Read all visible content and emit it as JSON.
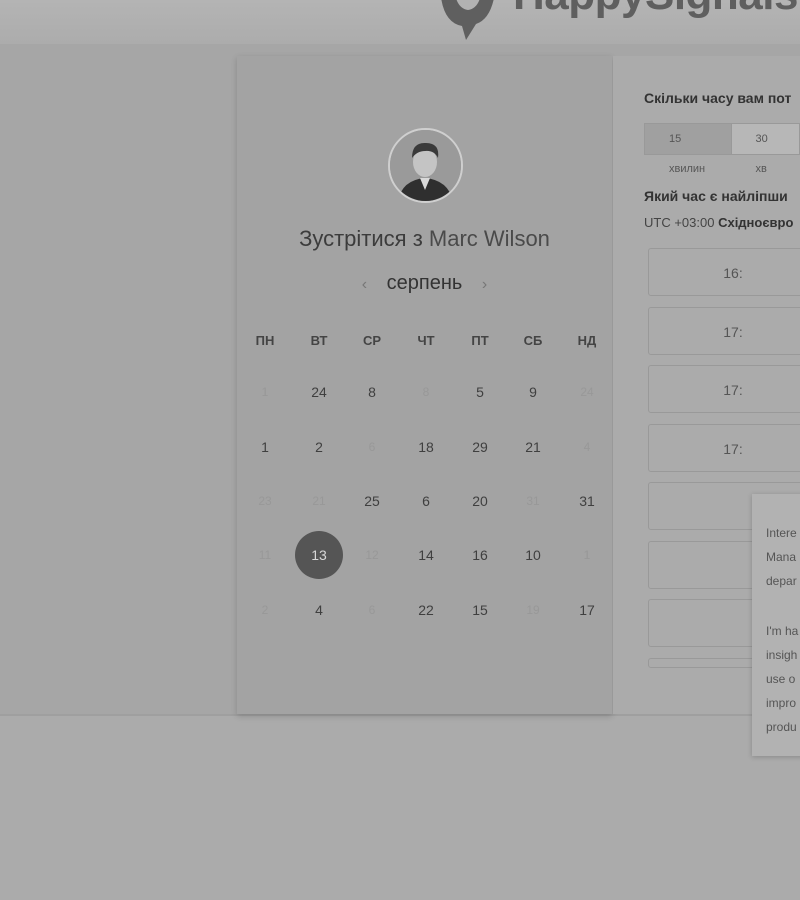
{
  "brand": {
    "name": "HappySignals"
  },
  "calendar": {
    "title_prefix": "Зустрітися з",
    "host_name": "Marc Wilson",
    "month": "серпень",
    "prev_arrow": "‹",
    "next_arrow": "›",
    "weekdays": [
      "ПН",
      "ВТ",
      "СР",
      "ЧТ",
      "ПТ",
      "СБ",
      "НД"
    ],
    "weeks": [
      [
        {
          "d": "1",
          "dim": true
        },
        {
          "d": "24"
        },
        {
          "d": "8"
        },
        {
          "d": "8",
          "dim": true
        },
        {
          "d": "5"
        },
        {
          "d": "9"
        },
        {
          "d": "24",
          "dim": true
        }
      ],
      [
        {
          "d": "1"
        },
        {
          "d": "2"
        },
        {
          "d": "6",
          "dim": true
        },
        {
          "d": "18"
        },
        {
          "d": "29"
        },
        {
          "d": "21"
        },
        {
          "d": "4",
          "dim": true
        }
      ],
      [
        {
          "d": "23",
          "dim": true
        },
        {
          "d": "21",
          "dim": true
        },
        {
          "d": "25"
        },
        {
          "d": "6"
        },
        {
          "d": "20"
        },
        {
          "d": "31",
          "dim": true
        },
        {
          "d": "31"
        }
      ],
      [
        {
          "d": "11",
          "dim": true
        },
        {
          "d": "13",
          "selected": true
        },
        {
          "d": "12",
          "dim": true
        },
        {
          "d": "14"
        },
        {
          "d": "16"
        },
        {
          "d": "10"
        },
        {
          "d": "1",
          "dim": true
        }
      ],
      [
        {
          "d": "2",
          "dim": true
        },
        {
          "d": "4"
        },
        {
          "d": "6",
          "dim": true
        },
        {
          "d": "22"
        },
        {
          "d": "15"
        },
        {
          "d": "19",
          "dim": true
        },
        {
          "d": "17"
        }
      ]
    ]
  },
  "booking": {
    "duration_question": "Скільки часу вам пот",
    "duration_options": [
      "15 хвилин",
      "30 хв"
    ],
    "time_question": "Який час є найліпши",
    "timezone_prefix": "UTC +03:00",
    "timezone_name": "Східноєвро",
    "slots": [
      "16:",
      "17:",
      "17:",
      "17:",
      "",
      "",
      "",
      ""
    ]
  },
  "popup": {
    "lines": [
      "Intere",
      "Mana",
      "depar",
      "",
      "I'm ha",
      "insigh",
      "use o",
      "impro",
      "produ"
    ]
  }
}
